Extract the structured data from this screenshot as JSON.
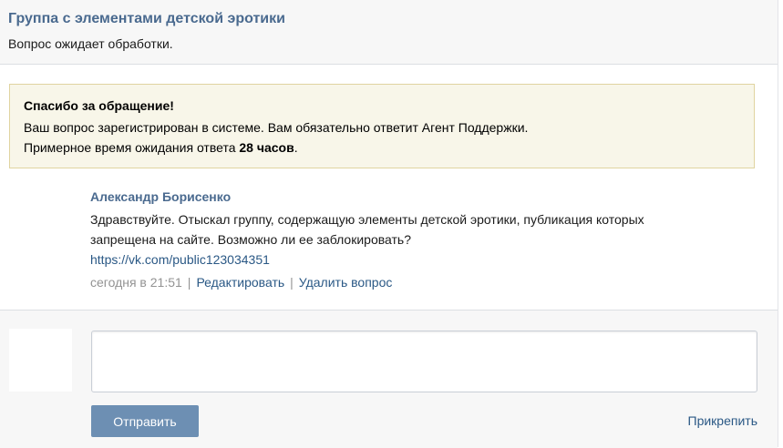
{
  "question": {
    "title": "Группа с элементами детской эротики",
    "status": "Вопрос ожидает обработки."
  },
  "notice": {
    "title": "Спасибо за обращение!",
    "line1": "Ваш вопрос зарегистрирован в системе. Вам обязательно ответит Агент Поддержки.",
    "line2_prefix": "Примерное время ожидания ответа ",
    "line2_bold": "28 часов",
    "line2_suffix": "."
  },
  "post": {
    "author": "Александр Борисенко",
    "text": "Здравствуйте. Отыскал группу, содержащую элементы детской эротики, публикация которых запрещена на сайте. Возможно ли ее заблокировать?",
    "link": "https://vk.com/public123034351",
    "time": "сегодня в 21:51",
    "separator": "|",
    "edit_label": "Редактировать",
    "delete_label": "Удалить вопрос"
  },
  "composer": {
    "placeholder": "",
    "send_label": "Отправить",
    "attach_label": "Прикрепить"
  },
  "colors": {
    "accent": "#4a6a8f",
    "link": "#2a5885",
    "button": "#6d8fb3",
    "notice_bg": "#f8f6e9",
    "notice_border": "#e0d4a0"
  }
}
